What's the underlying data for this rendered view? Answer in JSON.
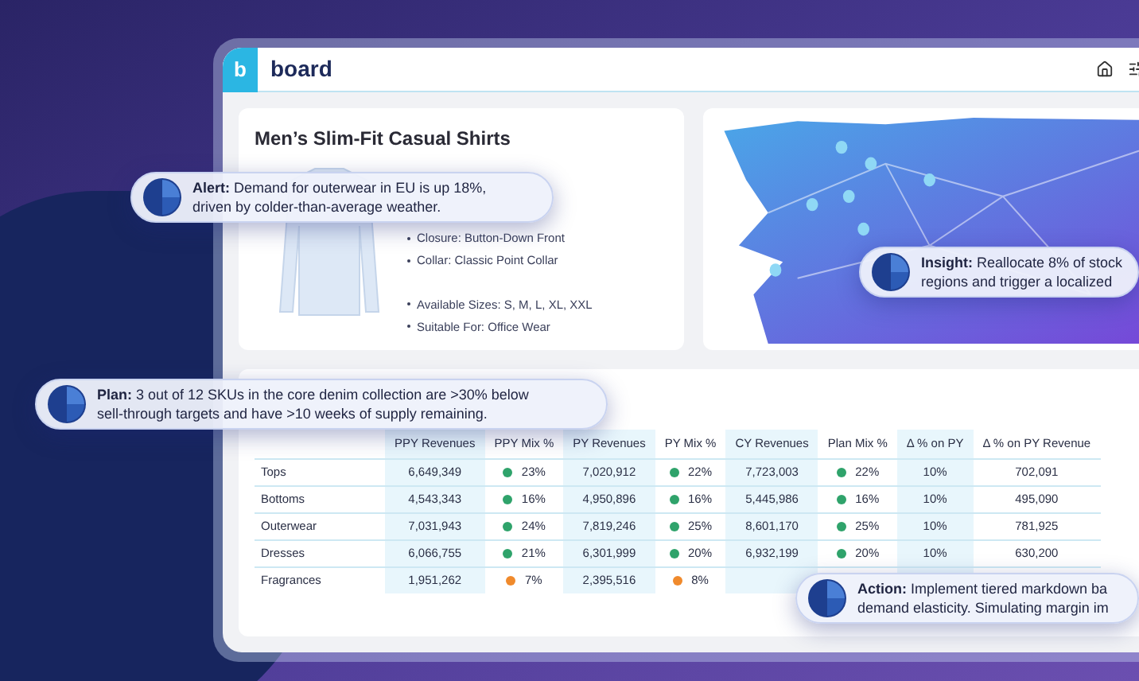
{
  "header": {
    "logo_letter": "b",
    "logo_text": "board"
  },
  "product": {
    "title": "Men’s Slim-Fit Casual Shirts",
    "specs": [
      "Closure: Button-Down Front",
      "Collar: Classic Point Collar"
    ],
    "specs_more": [
      "Available Sizes: S, M, L, XL, XXL",
      "Suitable For: Office Wear"
    ]
  },
  "table": {
    "columns": [
      "PPY Revenues",
      "PPY Mix %",
      "PY Revenues",
      "PY Mix %",
      "CY Revenues",
      "Plan Mix %",
      "Δ % on PY",
      "Δ % on PY Revenue"
    ],
    "rows": [
      {
        "label": "Tops",
        "cells": [
          {
            "kind": "value",
            "text": "6,649,349"
          },
          {
            "kind": "mix",
            "text": "23%",
            "color": "#2fa36b"
          },
          {
            "kind": "value",
            "text": "7,020,912"
          },
          {
            "kind": "mix",
            "text": "22%",
            "color": "#2fa36b"
          },
          {
            "kind": "value",
            "text": "7,723,003"
          },
          {
            "kind": "mix",
            "text": "22%",
            "color": "#2fa36b"
          },
          {
            "kind": "value",
            "text": "10%"
          },
          {
            "kind": "value",
            "text": "702,091"
          }
        ]
      },
      {
        "label": "Bottoms",
        "cells": [
          {
            "kind": "value",
            "text": "4,543,343"
          },
          {
            "kind": "mix",
            "text": "16%",
            "color": "#2fa36b"
          },
          {
            "kind": "value",
            "text": "4,950,896"
          },
          {
            "kind": "mix",
            "text": "16%",
            "color": "#2fa36b"
          },
          {
            "kind": "value",
            "text": "5,445,986"
          },
          {
            "kind": "mix",
            "text": "16%",
            "color": "#2fa36b"
          },
          {
            "kind": "value",
            "text": "10%"
          },
          {
            "kind": "value",
            "text": "495,090"
          }
        ]
      },
      {
        "label": "Outerwear",
        "cells": [
          {
            "kind": "value",
            "text": "7,031,943"
          },
          {
            "kind": "mix",
            "text": "24%",
            "color": "#2fa36b"
          },
          {
            "kind": "value",
            "text": "7,819,246"
          },
          {
            "kind": "mix",
            "text": "25%",
            "color": "#2fa36b"
          },
          {
            "kind": "value",
            "text": "8,601,170"
          },
          {
            "kind": "mix",
            "text": "25%",
            "color": "#2fa36b"
          },
          {
            "kind": "value",
            "text": "10%"
          },
          {
            "kind": "value",
            "text": "781,925"
          }
        ]
      },
      {
        "label": "Dresses",
        "cells": [
          {
            "kind": "value",
            "text": "6,066,755"
          },
          {
            "kind": "mix",
            "text": "21%",
            "color": "#2fa36b"
          },
          {
            "kind": "value",
            "text": "6,301,999"
          },
          {
            "kind": "mix",
            "text": "20%",
            "color": "#2fa36b"
          },
          {
            "kind": "value",
            "text": "6,932,199"
          },
          {
            "kind": "mix",
            "text": "20%",
            "color": "#2fa36b"
          },
          {
            "kind": "value",
            "text": "10%"
          },
          {
            "kind": "value",
            "text": "630,200"
          }
        ]
      },
      {
        "label": "Fragrances",
        "cells": [
          {
            "kind": "value",
            "text": "1,951,262"
          },
          {
            "kind": "mix",
            "text": "7%",
            "color": "#f08a2c"
          },
          {
            "kind": "value",
            "text": "2,395,516"
          },
          {
            "kind": "mix",
            "text": "8%",
            "color": "#f08a2c"
          }
        ]
      }
    ]
  },
  "callouts": [
    {
      "kind": "alert",
      "lines": [
        "**Alert:** Demand for outerwear in EU is up 18%,",
        "driven by colder-than-average weather."
      ]
    },
    {
      "kind": "insight",
      "lines": [
        "**Insight:** Reallocate 8% of stock",
        "regions and trigger a localized"
      ]
    },
    {
      "kind": "plan",
      "lines": [
        "**Plan:** 3 out of 12 SKUs in the core denim collection are >30% below",
        "sell-through targets and have >10 weeks of supply remaining."
      ]
    },
    {
      "kind": "action",
      "lines": [
        "**Action:** Implement tiered markdown ba",
        "demand elasticity. Simulating margin im"
      ]
    }
  ]
}
